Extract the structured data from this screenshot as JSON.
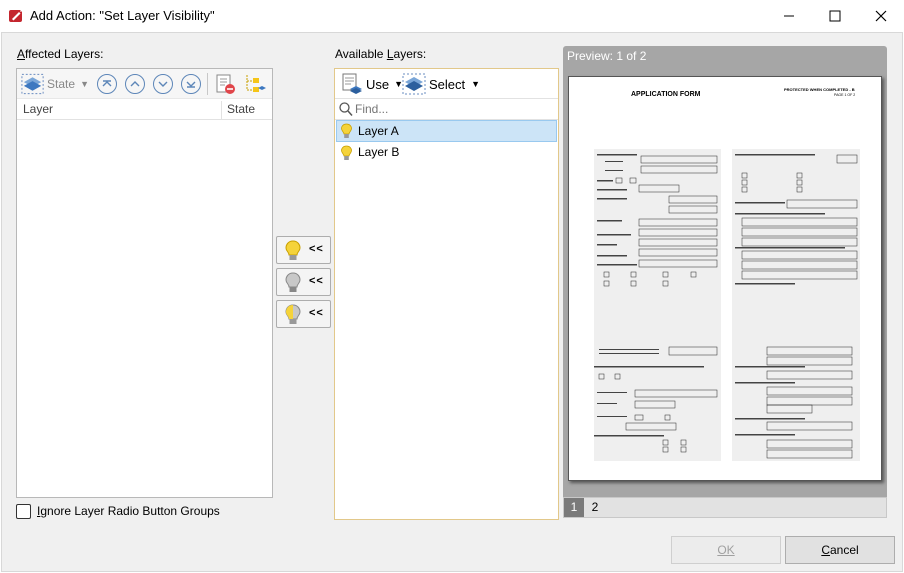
{
  "window": {
    "title": "Add Action: \"Set Layer Visibility\""
  },
  "affected": {
    "label": "Affected Layers:",
    "state_label": "State",
    "columns": [
      "Layer",
      "State"
    ]
  },
  "available": {
    "label": "Available Layers:",
    "use_label": "Use",
    "select_label": "Select",
    "find_placeholder": "Find...",
    "layers": [
      "Layer A",
      "Layer B"
    ]
  },
  "side_buttons": [
    "<<",
    "<<",
    "<<"
  ],
  "preview": {
    "label": "Preview: 1 of 2",
    "pages": [
      "1",
      "2"
    ],
    "doc": {
      "title": "APPLICATION FORM",
      "protected": "PROTECTED WHEN COMPLETED - B",
      "page_of": "PAGE 1 OF 2"
    }
  },
  "ignore_label": "Ignore Layer Radio Button Groups",
  "buttons": {
    "ok": "OK",
    "cancel": "Cancel"
  },
  "colors": {
    "selection": "#cce4f7",
    "accent": "#1979ca",
    "app_red": "#c4262e"
  }
}
